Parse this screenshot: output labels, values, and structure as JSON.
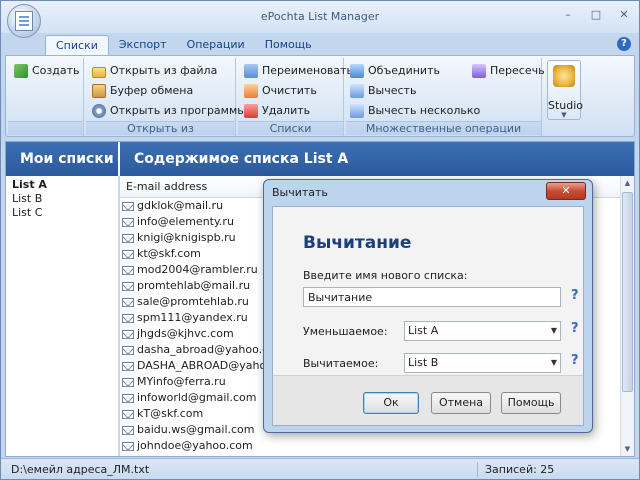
{
  "app": {
    "title": "ePochta List Manager"
  },
  "window_controls": {
    "minimize": "–",
    "maximize": "□",
    "close": "✕"
  },
  "ribbon": {
    "tabs": [
      {
        "label": "Списки",
        "active": true
      },
      {
        "label": "Экспорт",
        "active": false
      },
      {
        "label": "Операции",
        "active": false
      },
      {
        "label": "Помощь",
        "active": false
      }
    ],
    "help": "?",
    "create": "Создать",
    "open_group": {
      "caption": "Открыть из",
      "from_file": "Открыть из файла",
      "clipboard": "Буфер обмена",
      "from_program": "Открыть из программы"
    },
    "lists_group": {
      "caption": "Списки",
      "rename": "Переименовать",
      "clear": "Очистить",
      "delete": "Удалить"
    },
    "multi_group": {
      "caption": "Множественные операции",
      "merge": "Объединить",
      "subtract": "Вычесть",
      "subtract_several": "Вычесть несколько",
      "intersect": "Пересечь"
    },
    "studio": "Studio"
  },
  "left_panel": {
    "title": "Мои списки",
    "lists": [
      {
        "name": "List A",
        "selected": true
      },
      {
        "name": "List B",
        "selected": false
      },
      {
        "name": "List C",
        "selected": false
      }
    ]
  },
  "right_panel": {
    "title": "Содержимое списка List A",
    "column_header": "E-mail address",
    "emails": [
      "gdklok@mail.ru",
      "info@elementy.ru",
      "knigi@knigispb.ru",
      "kt@skf.com",
      "mod2004@rambler.ru",
      "promtehlab@mail.ru",
      "sale@promtehlab.ru",
      "spm111@yandex.ru",
      "jhgds@kjhvc.com",
      "dasha_abroad@yahoo.c...",
      "DASHA_ABROAD@yahoo....",
      "MYinfo@ferra.ru",
      "infoworld@gmail.com",
      "kT@skf.com",
      "baidu.ws@gmail.com",
      "johndoe@yahoo.com"
    ]
  },
  "status": {
    "path": "D:\\емейл адреса_ЛМ.txt",
    "count": "Записей: 25"
  },
  "dialog": {
    "window_title": "Вычитать",
    "close": "✕",
    "heading": "Вычитание",
    "name_label": "Введите имя нового списка:",
    "name_value": "Вычитание",
    "minuend_label": "Уменьшаемое:",
    "minuend_value": "List A",
    "subtrahend_label": "Вычитаемое:",
    "subtrahend_value": "List B",
    "help_mark": "?",
    "ok": "Ок",
    "cancel": "Отмена",
    "help": "Помощь"
  }
}
